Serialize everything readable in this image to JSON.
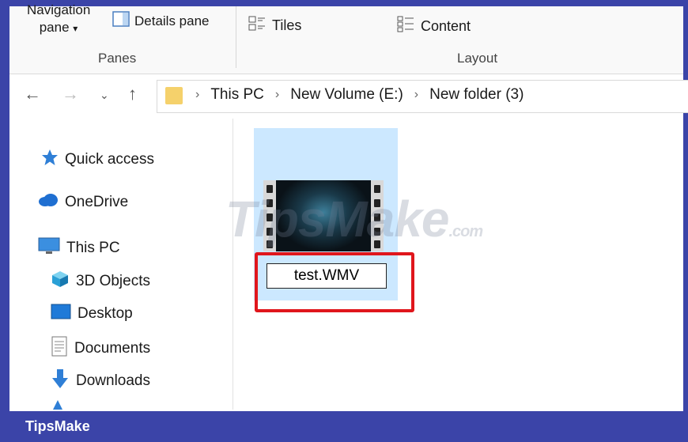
{
  "ribbon": {
    "navigation_pane_label": "Navigation pane",
    "navigation_pane_arrow": "▾",
    "details_pane_label": "Details pane",
    "panes_group_label": "Panes",
    "tiles_label": "Tiles",
    "content_label": "Content",
    "layout_group_label": "Layout"
  },
  "address": {
    "crumbs": [
      "This PC",
      "New Volume (E:)",
      "New folder (3)"
    ]
  },
  "sidebar": {
    "items": [
      {
        "label": "Quick access",
        "icon": "star-icon"
      },
      {
        "label": "OneDrive",
        "icon": "cloud-icon"
      },
      {
        "label": "This PC",
        "icon": "monitor-icon"
      },
      {
        "label": "3D Objects",
        "icon": "cube-icon"
      },
      {
        "label": "Desktop",
        "icon": "desktop-icon"
      },
      {
        "label": "Documents",
        "icon": "document-icon"
      },
      {
        "label": "Downloads",
        "icon": "download-icon"
      }
    ]
  },
  "file": {
    "rename_value": "test.WMV"
  },
  "watermark": {
    "text": "TipsMake",
    "suffix": ".com"
  },
  "footer": {
    "brand": "TipsMake"
  },
  "colors": {
    "frame": "#3b44a8",
    "selection": "#cce8ff",
    "highlight": "#e0161c",
    "folder": "#f5d16b"
  }
}
